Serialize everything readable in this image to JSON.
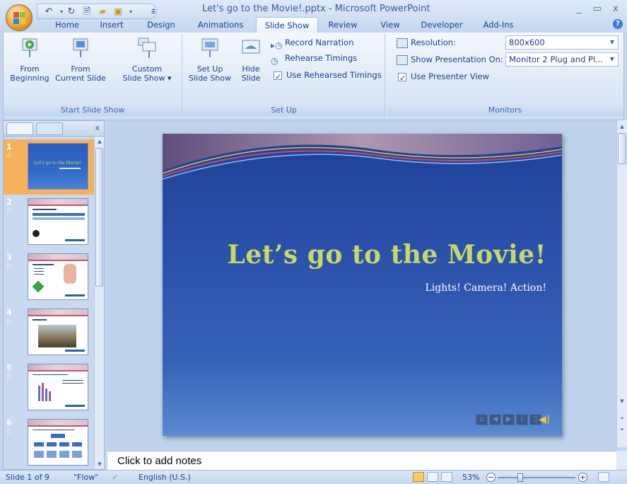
{
  "window": {
    "title": "Let's go to the Movie!.pptx - Microsoft PowerPoint",
    "controls": [
      "_",
      "▭",
      "x"
    ]
  },
  "tabs": [
    "Home",
    "Insert",
    "Design",
    "Animations",
    "Slide Show",
    "Review",
    "View",
    "Developer",
    "Add-Ins"
  ],
  "active_tab": "Slide Show",
  "ribbon": {
    "start_slide_show": {
      "label": "Start Slide Show",
      "from_beginning": [
        "From",
        "Beginning"
      ],
      "from_current": [
        "From",
        "Current Slide"
      ],
      "custom": [
        "Custom",
        "Slide Show ▾"
      ]
    },
    "set_up": {
      "label": "Set Up",
      "set_up_show": [
        "Set Up",
        "Slide Show"
      ],
      "hide_slide": [
        "Hide",
        "Slide"
      ],
      "record_narration": "Record Narration",
      "rehearse_timings": "Rehearse Timings",
      "use_rehearsed_timings": "Use Rehearsed Timings"
    },
    "monitors": {
      "label": "Monitors",
      "resolution_label": "Resolution:",
      "resolution_value": "800x600",
      "show_on_label": "Show Presentation On:",
      "show_on_value": "Monitor 2 Plug and Pl...",
      "use_presenter_view": "Use Presenter View"
    }
  },
  "slides_panel": {
    "close": "x",
    "thumbnails": [
      {
        "num": "1",
        "title": "Let's go to the Movie!",
        "selected": true
      },
      {
        "num": "2",
        "title": "Common Categories"
      },
      {
        "num": "3",
        "title": "Types of Movies"
      },
      {
        "num": "4",
        "title": "Viewing"
      },
      {
        "num": "5",
        "title": "Common Movie Genres"
      },
      {
        "num": "6",
        "title": "Chart of Movie Showings"
      }
    ]
  },
  "slide": {
    "title": "Let’s go to the Movie!",
    "subtitle": "Lights! Camera! Action!"
  },
  "notes": {
    "placeholder": "Click to add notes"
  },
  "status": {
    "slide_of": "Slide 1 of 9",
    "theme": "\"Flow\"",
    "language": "English (U.S.)",
    "zoom": "53%"
  },
  "colors": {
    "slide_title": "#c7d76b",
    "selected_thumb": "#f7b15c",
    "ribbon_text": "#15428b"
  }
}
